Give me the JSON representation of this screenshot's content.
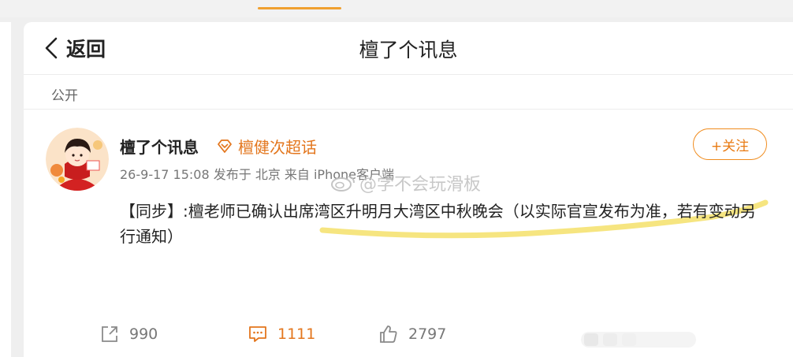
{
  "nav": {
    "back_label": "返回",
    "title": "檀了个讯息"
  },
  "post": {
    "visibility": "公开",
    "author": "檀了个讯息",
    "supertopic": "檀健次超话",
    "meta": "26-9-17 15:08  发布于 北京  来自 iPhone客户端",
    "follow_label": "+关注",
    "text": "【同步】:檀老师已确认出席湾区升明月大湾区中秋晚会（以实际官宣发布为准，若有变动另行通知）"
  },
  "watermark": {
    "text": "@学不会玩滑板"
  },
  "actions": {
    "share_count": "990",
    "comment_count": "1111",
    "like_count": "2797"
  },
  "colors": {
    "accent": "#e3761d",
    "highlight": "#f5e06a"
  },
  "icons": [
    "back-chevron-icon",
    "supertopic-diamond-icon",
    "weibo-logo-icon",
    "share-icon",
    "comment-icon",
    "like-icon"
  ]
}
